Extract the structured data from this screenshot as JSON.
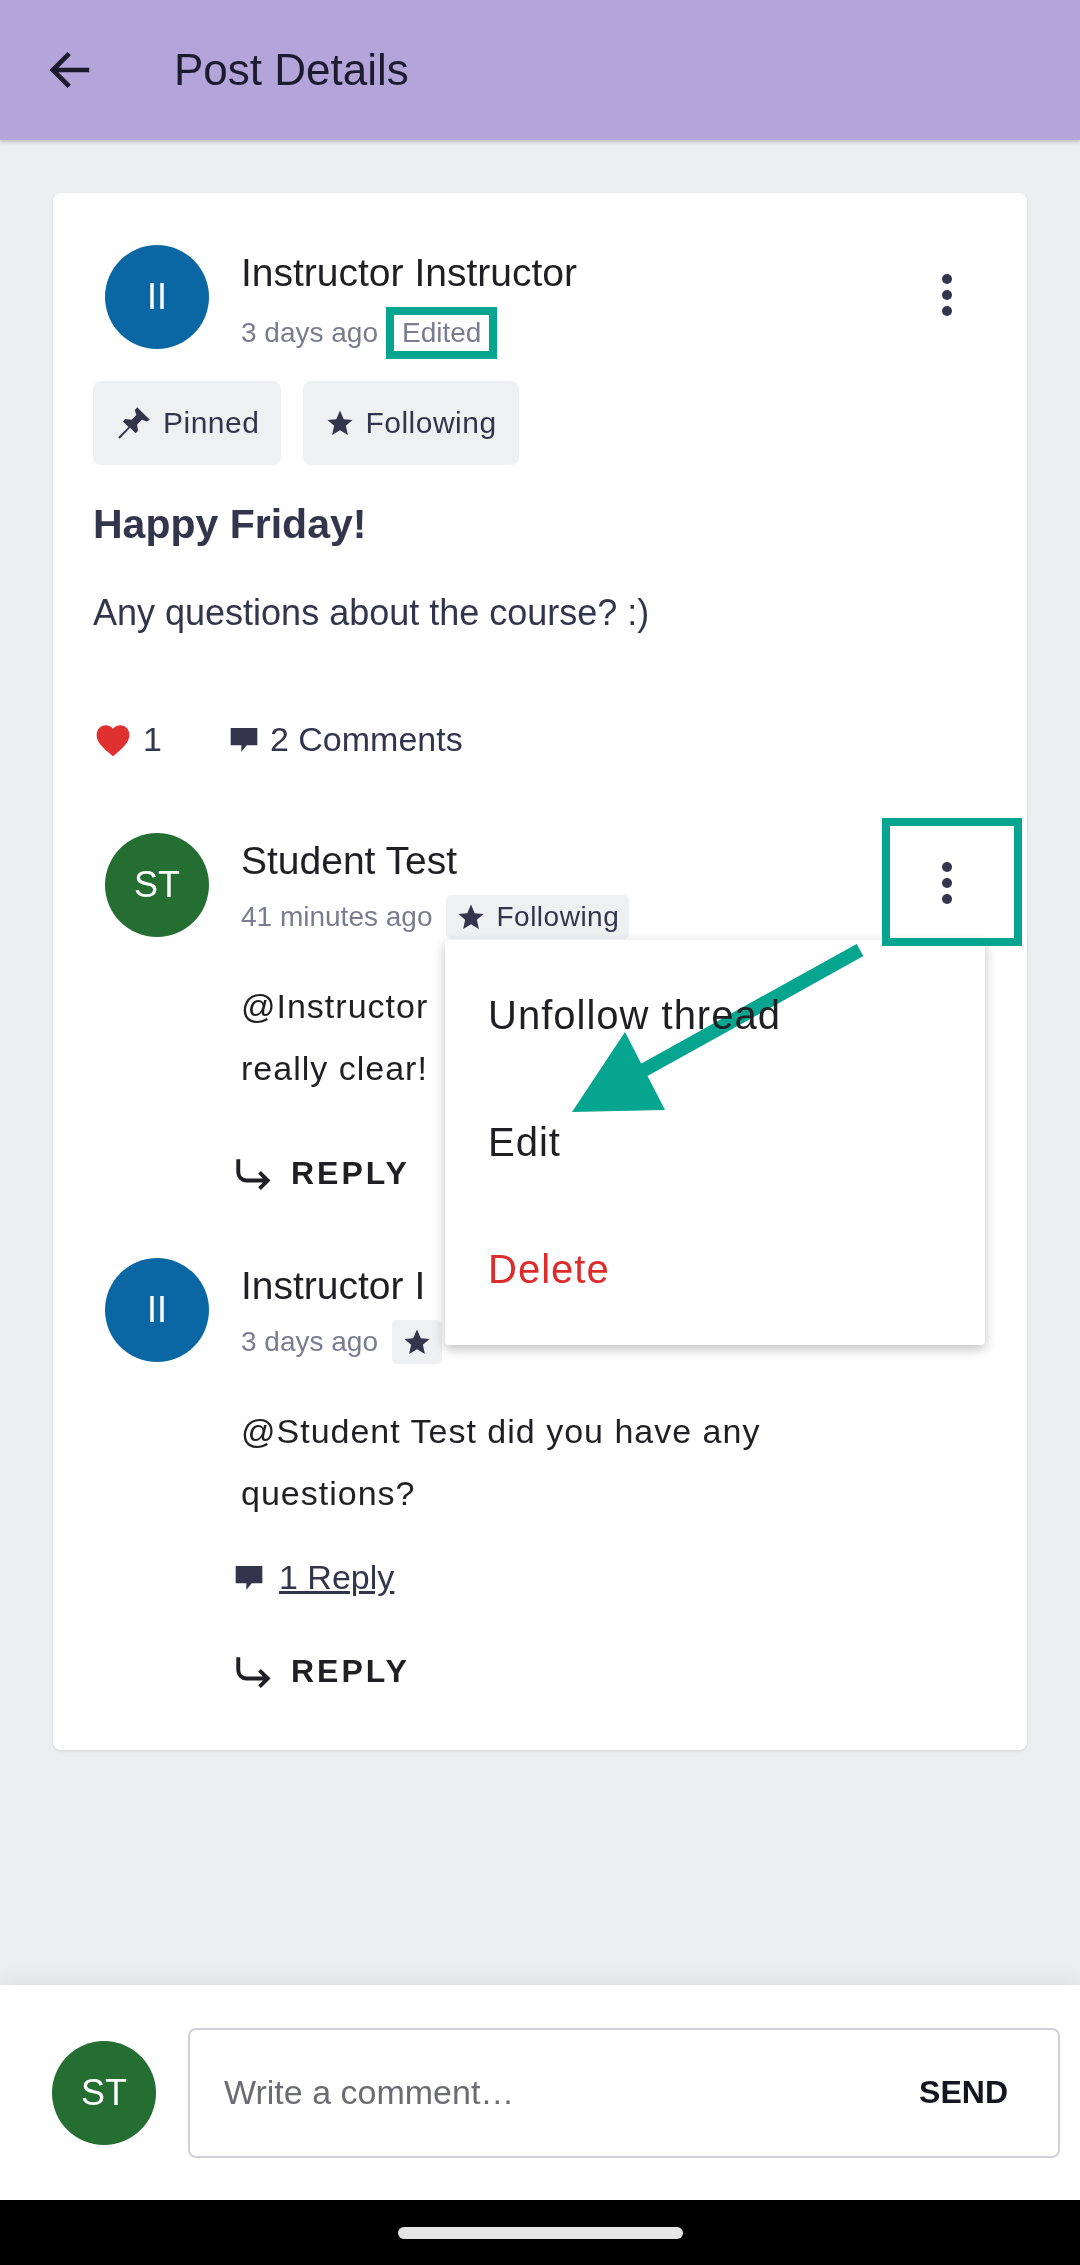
{
  "app_bar": {
    "title": "Post Details"
  },
  "post": {
    "author": {
      "initials": "II",
      "name": "Instructor Instructor",
      "color": "#0b67a3"
    },
    "time": "3 days ago",
    "edited": "Edited",
    "tags": [
      {
        "kind": "pinned",
        "label": "Pinned"
      },
      {
        "kind": "following",
        "label": "Following"
      }
    ],
    "title": "Happy Friday!",
    "body": "Any questions about the course? :)",
    "likes": "1",
    "liked": true,
    "comments": "2 Comments"
  },
  "comments": [
    {
      "initials": "ST",
      "name": "Student Test",
      "color": "#236e30",
      "time": "41 minutes ago",
      "tag": {
        "kind": "following",
        "label": "Following"
      },
      "body_lines": [
        "@Instructor",
        "really clear!"
      ],
      "reply": "REPLY"
    },
    {
      "initials": "II",
      "name": "Instructor I",
      "color": "#0b67a3",
      "time": "3 days ago",
      "tag": {
        "kind": "following"
      },
      "body_lines": [
        "@Student Test did you have any",
        "questions?"
      ],
      "replies_link": "1 Reply",
      "reply": "REPLY"
    }
  ],
  "menu": {
    "items": [
      {
        "label": "Unfollow thread",
        "kind": "normal"
      },
      {
        "label": "Edit",
        "kind": "normal"
      },
      {
        "label": "Delete",
        "kind": "danger"
      }
    ]
  },
  "composer": {
    "initials": "ST",
    "color": "#236e30",
    "placeholder": "Write a comment…",
    "send": "SEND"
  }
}
